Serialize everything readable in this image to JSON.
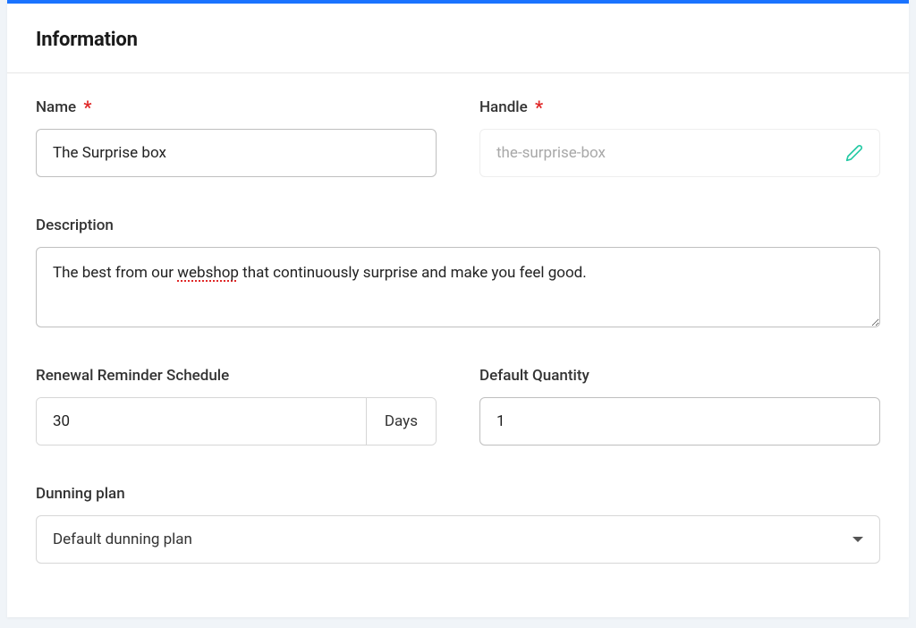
{
  "section": {
    "title": "Information"
  },
  "fields": {
    "name": {
      "label": "Name",
      "value": "The Surprise box",
      "required_mark": "*"
    },
    "handle": {
      "label": "Handle",
      "value": "the-surprise-box",
      "required_mark": "*",
      "edit_icon": "pencil-icon"
    },
    "description": {
      "label": "Description",
      "value_prefix": "The best from our ",
      "value_spellcheck_word": "webshop",
      "value_suffix": " that continuously surprise and make you feel good."
    },
    "renewal": {
      "label": "Renewal Reminder Schedule",
      "value": "30",
      "unit": "Days"
    },
    "default_quantity": {
      "label": "Default Quantity",
      "value": "1"
    },
    "dunning": {
      "label": "Dunning plan",
      "selected": "Default dunning plan"
    }
  },
  "colors": {
    "accent_bar": "#1a73ff",
    "required": "#e02828",
    "edit_icon": "#24c9a4"
  }
}
